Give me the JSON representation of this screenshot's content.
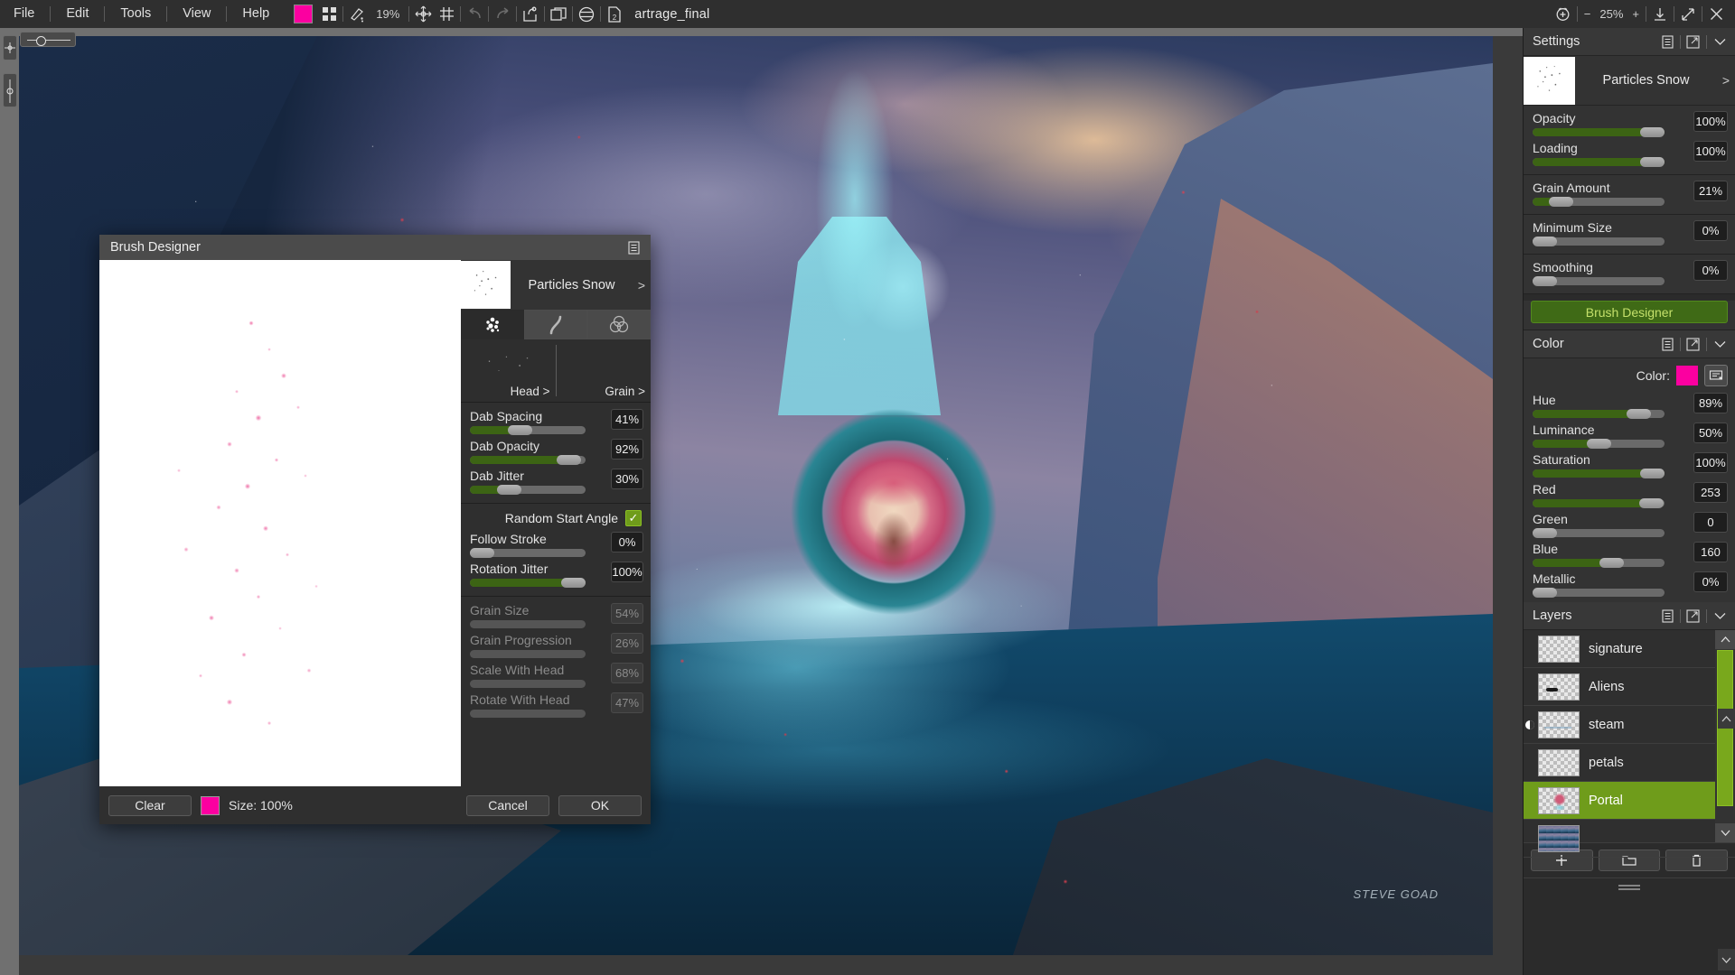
{
  "menu": {
    "items": [
      "File",
      "Edit",
      "Tools",
      "View",
      "Help"
    ],
    "color_swatch": "#fb00a0",
    "zoom": "19%",
    "document_title": "artrage_final",
    "icons": [
      "color-swatch",
      "grid-icon",
      "brush-icon",
      "move-icon",
      "grid-toggle-icon",
      "undo-icon",
      "redo-icon",
      "export-icon",
      "duplicate-icon",
      "blend-icon",
      "page-2-icon"
    ]
  },
  "window_controls": {
    "rotate_label": "rotate-view-icon",
    "zoom_out": "−",
    "zoom_level": "25%",
    "zoom_in": "+",
    "download": "download-icon",
    "expand": "expand-icon",
    "close": "×"
  },
  "settings": {
    "title": "Settings",
    "brush_name": "Particles Snow",
    "chevron": ">",
    "sliders": [
      {
        "label": "Opacity",
        "value": "100%",
        "pct": 100
      },
      {
        "label": "Loading",
        "value": "100%",
        "pct": 100
      },
      {
        "label": "Grain Amount",
        "value": "21%",
        "pct": 21
      },
      {
        "label": "Minimum Size",
        "value": "0%",
        "pct": 0
      },
      {
        "label": "Smoothing",
        "value": "0%",
        "pct": 0
      }
    ],
    "brush_designer_button": "Brush Designer"
  },
  "color": {
    "title": "Color",
    "color_label": "Color:",
    "swatch": "#fb00a0",
    "sliders": [
      {
        "label": "Hue",
        "value": "89%",
        "pct": 89
      },
      {
        "label": "Luminance",
        "value": "50%",
        "pct": 50
      },
      {
        "label": "Saturation",
        "value": "100%",
        "pct": 100
      },
      {
        "label": "Red",
        "value": "253",
        "pct": 99
      },
      {
        "label": "Green",
        "value": "0",
        "pct": 0
      },
      {
        "label": "Blue",
        "value": "160",
        "pct": 63
      },
      {
        "label": "Metallic",
        "value": "0%",
        "pct": 0
      }
    ]
  },
  "layers": {
    "title": "Layers",
    "items": [
      {
        "name": "signature",
        "selected": false,
        "visibility_icon": false
      },
      {
        "name": "Aliens",
        "selected": false,
        "visibility_icon": false
      },
      {
        "name": "steam",
        "selected": false,
        "visibility_icon": true
      },
      {
        "name": "petals",
        "selected": false,
        "visibility_icon": false
      },
      {
        "name": "Portal",
        "selected": true,
        "visibility_icon": false
      },
      {
        "name": "",
        "selected": false,
        "visibility_icon": false
      }
    ],
    "buttons": [
      "add-layer",
      "layer-group",
      "delete-layer"
    ],
    "selected_color": "#6f9c1b"
  },
  "brush_designer": {
    "title": "Brush Designer",
    "brush_name": "Particles Snow",
    "chevron": ">",
    "tabs": [
      "particles-tab",
      "curve-tab",
      "blend-tab"
    ],
    "head_label": "Head >",
    "grain_label": "Grain >",
    "sliders_main": [
      {
        "label": "Dab Spacing",
        "value": "41%",
        "pct": 41
      },
      {
        "label": "Dab Opacity",
        "value": "92%",
        "pct": 92
      },
      {
        "label": "Dab Jitter",
        "value": "30%",
        "pct": 30
      }
    ],
    "checkbox": {
      "label": "Random Start Angle",
      "checked": true,
      "mark": "✓"
    },
    "sliders_rotation": [
      {
        "label": "Follow Stroke",
        "value": "0%",
        "pct": 0
      },
      {
        "label": "Rotation Jitter",
        "value": "100%",
        "pct": 100
      }
    ],
    "sliders_grain": [
      {
        "label": "Grain Size",
        "value": "54%",
        "pct": 54
      },
      {
        "label": "Grain Progression",
        "value": "26%",
        "pct": 26
      },
      {
        "label": "Scale With Head",
        "value": "68%",
        "pct": 68
      },
      {
        "label": "Rotate With Head",
        "value": "47%",
        "pct": 47
      }
    ],
    "footer": {
      "clear": "Clear",
      "swatch": "#fb00a0",
      "size": "Size: 100%",
      "cancel": "Cancel",
      "ok": "OK"
    }
  },
  "canvas": {
    "signature": "STEVE GOAD"
  }
}
